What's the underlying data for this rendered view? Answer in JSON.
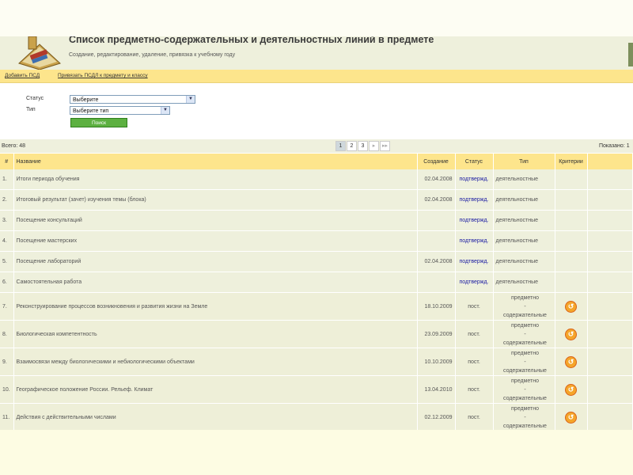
{
  "header": {
    "title": "Список предметно-содержательных и деятельностных линий в предмете",
    "subtitle": "Создание, редактирование, удаление, привязка к учебному году"
  },
  "toolbar": {
    "add_label": "Добавить ПСД",
    "bind_label": "Привязать ПСДЛ к предмету и классу"
  },
  "filters": {
    "status_label": "Статус",
    "status_value": "Выберите",
    "type_label": "Тип",
    "type_value": "Выберите тип",
    "search_label": "Поиск"
  },
  "info": {
    "total": "Всего: 48",
    "shown": "Показано: 1",
    "pages": [
      "1",
      "2",
      "3"
    ],
    "current_page": "1"
  },
  "table": {
    "columns": [
      "#",
      "Название",
      "Создание",
      "Статус",
      "Тип",
      "Критерии"
    ],
    "rows": [
      {
        "num": "1.",
        "name": "Итоги периода обучения",
        "created": "02.04.2008",
        "status": "подтвержд.",
        "type": "деятельностные"
      },
      {
        "num": "2.",
        "name": "Итоговый результат (зачет) изучения темы (блока)",
        "created": "02.04.2008",
        "status": "подтвержд.",
        "type": "деятельностные"
      },
      {
        "num": "3.",
        "name": "Посещение консультаций",
        "created": "",
        "status": "подтвержд.",
        "type": "деятельностные"
      },
      {
        "num": "4.",
        "name": "Посещение мастерских",
        "created": "",
        "status": "подтвержд.",
        "type": "деятельностные"
      },
      {
        "num": "5.",
        "name": "Посещение лабораторий",
        "created": "02.04.2008",
        "status": "подтвержд.",
        "type": "деятельностные"
      },
      {
        "num": "6.",
        "name": "Самостоятельная работа",
        "created": "",
        "status": "подтвержд.",
        "type": "деятельностные"
      },
      {
        "num": "7.",
        "name": "Реконструирование процессов возникновения и развития жизни на Земле",
        "created": "18.10.2009",
        "status": "пост.",
        "type": [
          "предметно",
          "-",
          "содержательные"
        ],
        "criteria_icon": "criteria-icon"
      },
      {
        "num": "8.",
        "name": "Биологическая компетентность",
        "created": "23.09.2009",
        "status": "пост.",
        "type": [
          "предметно",
          "-",
          "содержательные"
        ],
        "criteria_icon": "criteria-icon"
      },
      {
        "num": "9.",
        "name": "Взаимосвязи между биологическими и небиологическими объектами",
        "created": "10.10.2009",
        "status": "пост.",
        "type": [
          "предметно",
          "-",
          "содержательные"
        ],
        "criteria_icon": "criteria-icon"
      },
      {
        "num": "10.",
        "name": "Географическое положение России. Рельеф. Климат",
        "created": "13.04.2010",
        "status": "пост.",
        "type": [
          "предметно",
          "-",
          "содержательные"
        ],
        "criteria_icon": "criteria-icon"
      },
      {
        "num": "11.",
        "name": "Действия с действительными числами",
        "created": "02.12.2009",
        "status": "пост.",
        "type": [
          "предметно",
          "-",
          "содержательные"
        ],
        "criteria_icon": "criteria-icon"
      }
    ]
  },
  "colors": {
    "header_bg": "#eef0dc",
    "toolbar_bg": "#fde58c",
    "button_green": "#5cb040",
    "status_link": "#1b1ba2",
    "criteria_icon": "#f5a52a"
  }
}
